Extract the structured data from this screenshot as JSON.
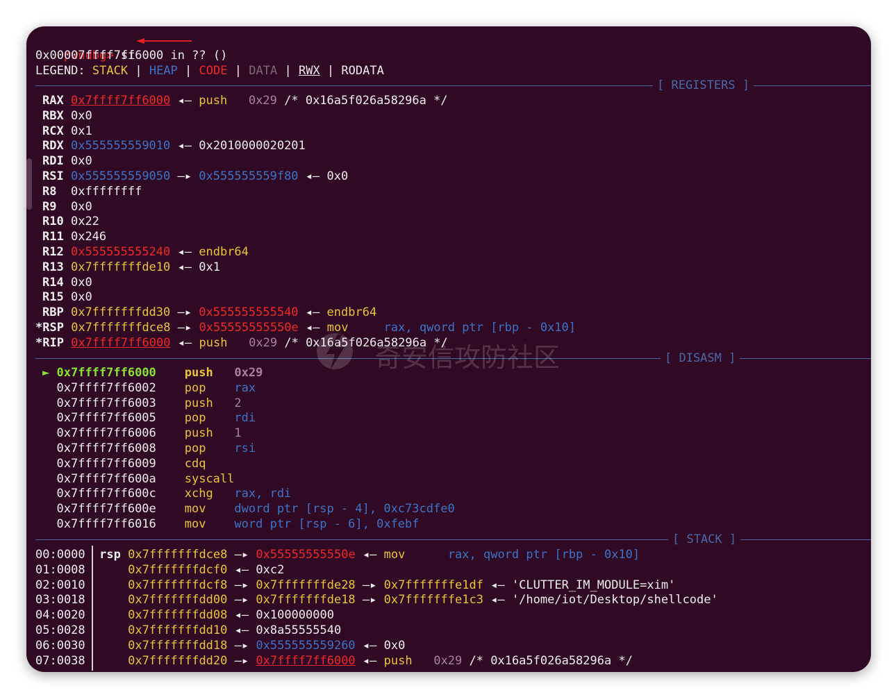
{
  "prompt": {
    "label": "pwndbg>",
    "command": "si"
  },
  "location": "0x00007ffff7ff6000 in ?? ()",
  "legend": {
    "prefix": "LEGEND:",
    "items": [
      "STACK",
      "HEAP",
      "CODE",
      "DATA",
      "RWX",
      "RODATA"
    ],
    "sep": "|"
  },
  "sections": {
    "registers": "[ REGISTERS ]",
    "disasm": "[ DISASM ]",
    "stack": "[ STACK ]"
  },
  "arrows": {
    "right": "—▸",
    "left": "◂—"
  },
  "registers": [
    {
      "name": "RAX",
      "v1": "0x7ffff7ff6000",
      "a1": "◂—",
      "v2": "push",
      "v3": "0x29",
      "v4": "/* 0x16a5f026a58296a */"
    },
    {
      "name": "RBX",
      "v1": "0x0"
    },
    {
      "name": "RCX",
      "v1": "0x1"
    },
    {
      "name": "RDX",
      "v1": "0x555555559010",
      "a1": "◂—",
      "v2": "0x2010000020201"
    },
    {
      "name": "RDI",
      "v1": "0x0"
    },
    {
      "name": "RSI",
      "v1": "0x555555559050",
      "a1": "—▸",
      "v2": "0x555555559f80",
      "a2": "◂—",
      "v3": "0x0"
    },
    {
      "name": "R8",
      "v1": "0xffffffff"
    },
    {
      "name": "R9",
      "v1": "0x0"
    },
    {
      "name": "R10",
      "v1": "0x22"
    },
    {
      "name": "R11",
      "v1": "0x246"
    },
    {
      "name": "R12",
      "v1": "0x555555555240",
      "a1": "◂—",
      "v2": "endbr64"
    },
    {
      "name": "R13",
      "v1": "0x7fffffffde10",
      "a1": "◂—",
      "v2": "0x1"
    },
    {
      "name": "R14",
      "v1": "0x0"
    },
    {
      "name": "R15",
      "v1": "0x0"
    },
    {
      "name": "RBP",
      "v1": "0x7fffffffdd30",
      "a1": "—▸",
      "v2": "0x555555555540",
      "a2": "◂—",
      "v3": "endbr64"
    },
    {
      "name": "*RSP",
      "v1": "0x7fffffffdce8",
      "a1": "—▸",
      "v2": "0x55555555550e",
      "a2": "◂—",
      "v3": "mov",
      "v4": "rax, qword ptr [rbp - 0x10]"
    },
    {
      "name": "*RIP",
      "v1": "0x7ffff7ff6000",
      "a1": "◂—",
      "v2": "push",
      "v3": "0x29",
      "v4": "/* 0x16a5f026a58296a */"
    }
  ],
  "disasm": [
    {
      "marker": "►",
      "addr": "0x7ffff7ff6000",
      "mnem": "push",
      "ops": "0x29"
    },
    {
      "marker": "",
      "addr": "0x7ffff7ff6002",
      "mnem": "pop",
      "ops": "rax"
    },
    {
      "marker": "",
      "addr": "0x7ffff7ff6003",
      "mnem": "push",
      "ops": "2"
    },
    {
      "marker": "",
      "addr": "0x7ffff7ff6005",
      "mnem": "pop",
      "ops": "rdi"
    },
    {
      "marker": "",
      "addr": "0x7ffff7ff6006",
      "mnem": "push",
      "ops": "1"
    },
    {
      "marker": "",
      "addr": "0x7ffff7ff6008",
      "mnem": "pop",
      "ops": "rsi"
    },
    {
      "marker": "",
      "addr": "0x7ffff7ff6009",
      "mnem": "cdq",
      "ops": ""
    },
    {
      "marker": "",
      "addr": "0x7ffff7ff600a",
      "mnem": "syscall",
      "ops": ""
    },
    {
      "marker": "",
      "addr": "0x7ffff7ff600c",
      "mnem": "xchg",
      "ops": "rax, rdi"
    },
    {
      "marker": "",
      "addr": "0x7ffff7ff600e",
      "mnem": "mov",
      "ops": "dword ptr [rsp - 4], 0xc73cdfe0"
    },
    {
      "marker": "",
      "addr": "0x7ffff7ff6016",
      "mnem": "mov",
      "ops": "word ptr [rsp - 6], 0xfebf"
    }
  ],
  "stack": [
    {
      "idx": "00:0000",
      "reg": "rsp",
      "addr": "0x7fffffffdce8",
      "a1": "—▸",
      "v1": "0x55555555550e",
      "a2": "◂—",
      "v2": "mov",
      "v3": "rax, qword ptr [rbp - 0x10]"
    },
    {
      "idx": "01:0008",
      "reg": "",
      "addr": "0x7fffffffdcf0",
      "a1": "◂—",
      "v1": "0xc2"
    },
    {
      "idx": "02:0010",
      "reg": "",
      "addr": "0x7fffffffdcf8",
      "a1": "—▸",
      "v1": "0x7fffffffde28",
      "a2": "—▸",
      "v2": "0x7fffffffe1df",
      "a3": "◂—",
      "v3": "'CLUTTER_IM_MODULE=xim'"
    },
    {
      "idx": "03:0018",
      "reg": "",
      "addr": "0x7fffffffdd00",
      "a1": "—▸",
      "v1": "0x7fffffffde18",
      "a2": "—▸",
      "v2": "0x7fffffffe1c3",
      "a3": "◂—",
      "v3": "'/home/iot/Desktop/shellcode'"
    },
    {
      "idx": "04:0020",
      "reg": "",
      "addr": "0x7fffffffdd08",
      "a1": "◂—",
      "v1": "0x100000000"
    },
    {
      "idx": "05:0028",
      "reg": "",
      "addr": "0x7fffffffdd10",
      "a1": "◂—",
      "v1": "0x8a55555540"
    },
    {
      "idx": "06:0030",
      "reg": "",
      "addr": "0x7fffffffdd18",
      "a1": "—▸",
      "v1": "0x555555559260",
      "a2": "◂—",
      "v2": "0x0"
    },
    {
      "idx": "07:0038",
      "reg": "",
      "addr": "0x7fffffffdd20",
      "a1": "—▸",
      "v1": "0x7ffff7ff6000",
      "a2": "◂—",
      "v2": "push",
      "v3": "0x29",
      "v4": "/* 0x16a5f026a58296a */"
    }
  ],
  "watermark": "奇安信攻防社区",
  "colors": {
    "bg": "#300a24",
    "red": "#ef2929",
    "yellow": "#e9c43c",
    "blue": "#3d74c8",
    "purple": "#ad7fa8",
    "green": "#8ae234",
    "rule": "#4a69a8"
  }
}
